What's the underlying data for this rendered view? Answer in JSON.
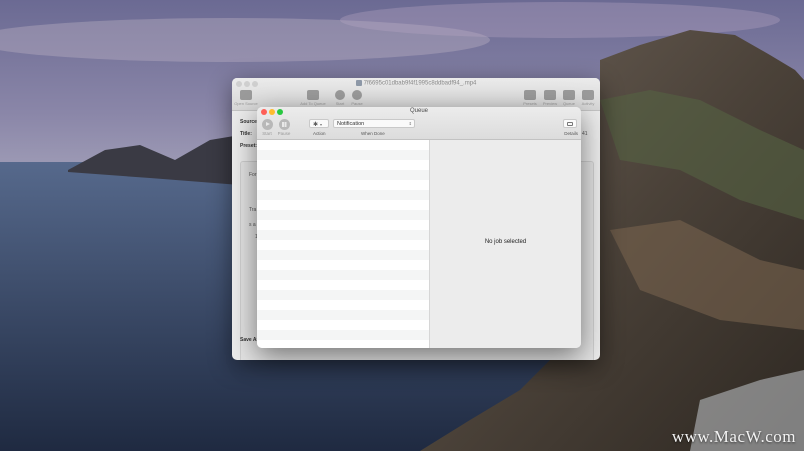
{
  "desktop": {
    "watermark": "www.MacW.com"
  },
  "main_window": {
    "title": "7f6695c01dbab9f4f1995c8ddbadf94_.mp4",
    "toolbar": [
      {
        "label": "Open Source",
        "icon": "film-icon"
      },
      {
        "label": "Add To Queue",
        "icon": "add-queue-icon"
      },
      {
        "label": "Start",
        "icon": "play-icon"
      },
      {
        "label": "Pause",
        "icon": "pause-icon"
      },
      {
        "label": "Presets",
        "icon": "presets-icon"
      },
      {
        "label": "Preview",
        "icon": "preview-icon"
      },
      {
        "label": "Queue",
        "icon": "queue-icon"
      },
      {
        "label": "Activity",
        "icon": "activity-icon"
      }
    ],
    "labels": {
      "source": "Source:",
      "title": "Title:",
      "preset": "Preset:",
      "save_as": "Save As:",
      "format_partial": "For",
      "tracks_partial": "Tra",
      "row_a": "s a",
      "row_b": "1",
      "title_value_partial": "41"
    }
  },
  "queue_window": {
    "title": "Queue",
    "toolbar": {
      "start_label": "Start",
      "pause_label": "Pause",
      "action_label": "Action",
      "when_done_label": "When Done",
      "when_done_value": "Notification",
      "details_label": "Details"
    },
    "job_rows": 21,
    "empty_message": "No job selected"
  }
}
